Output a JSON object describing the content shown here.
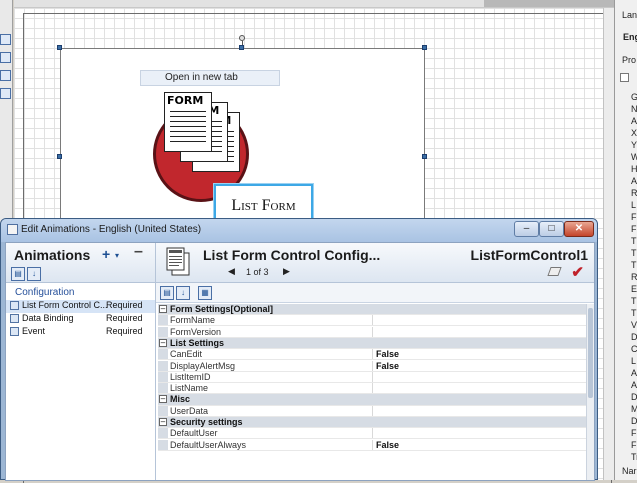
{
  "designer": {
    "tooltip": "Open in new tab",
    "form_graphic_title": "FORM",
    "list_form_label": "List Form"
  },
  "right_panel": {
    "items": [
      "Lan",
      "Engl",
      "Pro"
    ],
    "letters": [
      "G",
      "N",
      "A",
      "X",
      "Y",
      "W",
      "H",
      "A",
      "R",
      "L",
      "F",
      "F",
      "T",
      "T",
      "T",
      "R",
      "E",
      "T",
      "T",
      "V",
      "D",
      "C",
      "L",
      "A",
      "A",
      "D",
      "M",
      "D",
      "F",
      "F",
      "Tr"
    ],
    "bottom": "Nar"
  },
  "dialog": {
    "title": "Edit Animations - English (United States)",
    "window_controls": {
      "minimize": "–",
      "maximize": "□",
      "close": "✕"
    },
    "left": {
      "title": "Animations",
      "add_label": "+",
      "add_dropdown": "▾",
      "remove_label": "–",
      "sort_icons": [
        "▤",
        "↓"
      ],
      "group_label": "Configuration",
      "items": [
        {
          "name": "List Form Control C...",
          "status": "Required"
        },
        {
          "name": "Data Binding",
          "status": "Required"
        },
        {
          "name": "Event",
          "status": "Required"
        }
      ]
    },
    "right": {
      "title": "List Form Control Config...",
      "control_name": "ListFormControl1",
      "pager": {
        "prev": "◀",
        "text": "1 of 3",
        "next": "▶"
      },
      "check": "✔",
      "toolbar_icons": [
        "▤",
        "↓",
        "▦"
      ]
    },
    "properties": [
      {
        "type": "category",
        "name": "Form Settings[Optional]",
        "toggle": "–"
      },
      {
        "type": "prop",
        "name": "FormName",
        "value": ""
      },
      {
        "type": "prop",
        "name": "FormVersion",
        "value": ""
      },
      {
        "type": "category",
        "name": "List Settings",
        "toggle": "–"
      },
      {
        "type": "prop",
        "name": "CanEdit",
        "value": "False"
      },
      {
        "type": "prop",
        "name": "DisplayAlertMsg",
        "value": "False"
      },
      {
        "type": "prop",
        "name": "ListItemID",
        "value": ""
      },
      {
        "type": "prop",
        "name": "ListName",
        "value": ""
      },
      {
        "type": "category",
        "name": "Misc",
        "toggle": "–"
      },
      {
        "type": "prop",
        "name": "UserData",
        "value": ""
      },
      {
        "type": "category",
        "name": "Security settings",
        "toggle": "–"
      },
      {
        "type": "prop",
        "name": "DefaultUser",
        "value": ""
      },
      {
        "type": "prop",
        "name": "DefaultUserAlways",
        "value": "False"
      }
    ]
  }
}
